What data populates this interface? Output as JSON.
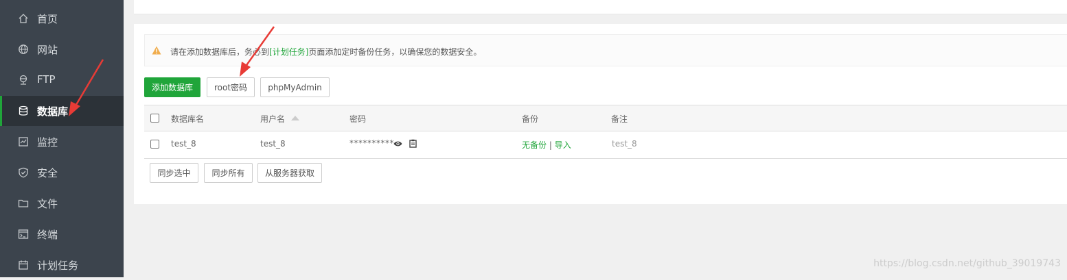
{
  "sidebar": {
    "items": [
      {
        "label": "首页",
        "icon": "home-icon"
      },
      {
        "label": "网站",
        "icon": "globe-icon"
      },
      {
        "label": "FTP",
        "icon": "ftp-icon"
      },
      {
        "label": "数据库",
        "icon": "database-icon",
        "active": true
      },
      {
        "label": "监控",
        "icon": "monitor-icon"
      },
      {
        "label": "安全",
        "icon": "shield-icon"
      },
      {
        "label": "文件",
        "icon": "folder-icon"
      },
      {
        "label": "终端",
        "icon": "terminal-icon"
      },
      {
        "label": "计划任务",
        "icon": "calendar-icon"
      }
    ]
  },
  "alert": {
    "prefix": "请在添加数据库后，务必到",
    "link": "[计划任务]",
    "suffix": "页面添加定时备份任务，以确保您的数据安全。"
  },
  "toolbar": {
    "add_db": "添加数据库",
    "root_password": "root密码",
    "phpmyadmin": "phpMyAdmin"
  },
  "table": {
    "headers": {
      "db_name": "数据库名",
      "username": "用户名",
      "password": "密码",
      "backup": "备份",
      "note": "备注"
    },
    "rows": [
      {
        "db_name": "test_8",
        "username": "test_8",
        "password": "**********",
        "backup_status": "无备份",
        "separator": "|",
        "import": "导入",
        "note": "test_8"
      }
    ]
  },
  "bottom_buttons": {
    "sync_selected": "同步选中",
    "sync_all": "同步所有",
    "fetch_from_server": "从服务器获取"
  },
  "watermark": "https://blog.csdn.net/github_39019743",
  "colors": {
    "sidebar_bg": "#3c444d",
    "sidebar_active_bg": "#2c3238",
    "accent_green": "#20a53a",
    "warning_orange": "#f0ad4e",
    "annotation_red": "#e83b36"
  }
}
